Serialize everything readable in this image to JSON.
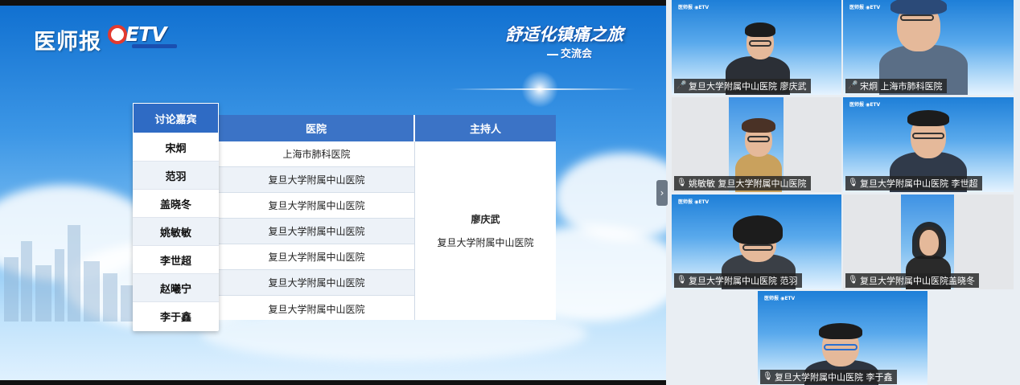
{
  "presentation": {
    "logo_text": "医师报",
    "etv_logo": "ETV",
    "event_title": "舒适化镇痛之旅",
    "event_subtitle": "交流会",
    "guests_header": "讨论嘉宾",
    "hospital_header": "医院",
    "host_header": "主持人",
    "guests": [
      {
        "name": "宋炯",
        "hospital": "上海市肺科医院"
      },
      {
        "name": "范羽",
        "hospital": "复旦大学附属中山医院"
      },
      {
        "name": "盖晓冬",
        "hospital": "复旦大学附属中山医院"
      },
      {
        "name": "姚敏敏",
        "hospital": "复旦大学附属中山医院"
      },
      {
        "name": "李世超",
        "hospital": "复旦大学附属中山医院"
      },
      {
        "name": "赵曦宁",
        "hospital": "复旦大学附属中山医院"
      },
      {
        "name": "李于鑫",
        "hospital": "复旦大学附属中山医院"
      }
    ],
    "host": {
      "name": "廖庆武",
      "hospital": "复旦大学附属中山医院"
    }
  },
  "panel_toggle": "›",
  "participants": [
    {
      "label": "复旦大学附属中山医院 廖庆武",
      "mic": "on"
    },
    {
      "label": "宋炯 上海市肺科医院",
      "mic": "on"
    },
    {
      "label": "姚敏敏 复旦大学附属中山医院",
      "mic": "muted"
    },
    {
      "label": "复旦大学附属中山医院 李世超",
      "mic": "muted"
    },
    {
      "label": "复旦大学附属中山医院 范羽",
      "mic": "muted"
    },
    {
      "label": "复旦大学附属中山医院盖晓冬",
      "mic": "muted"
    },
    {
      "label": "复旦大学附属中山医院 李于鑫",
      "mic": "muted"
    }
  ],
  "icons": {
    "mic_on": "mic-icon",
    "mic_muted": "mic-muted-icon"
  }
}
